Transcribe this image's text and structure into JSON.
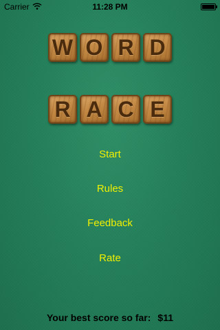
{
  "status_bar": {
    "carrier": "Carrier",
    "time": "11:28 PM",
    "wifi_icon": "wifi-icon",
    "battery_icon": "battery-icon",
    "battery_level": 1.0
  },
  "title": {
    "word": [
      "W",
      "O",
      "R",
      "D"
    ],
    "race": [
      "R",
      "A",
      "C",
      "E"
    ]
  },
  "menu": {
    "start": "Start",
    "rules": "Rules",
    "feedback": "Feedback",
    "rate": "Rate"
  },
  "score": {
    "label": "Your best score so far:",
    "value": "$11"
  },
  "colors": {
    "background": "#24805a",
    "menu_text": "#f2f000",
    "tile": "#c48a45",
    "tile_letter": "#4a2b0e"
  }
}
